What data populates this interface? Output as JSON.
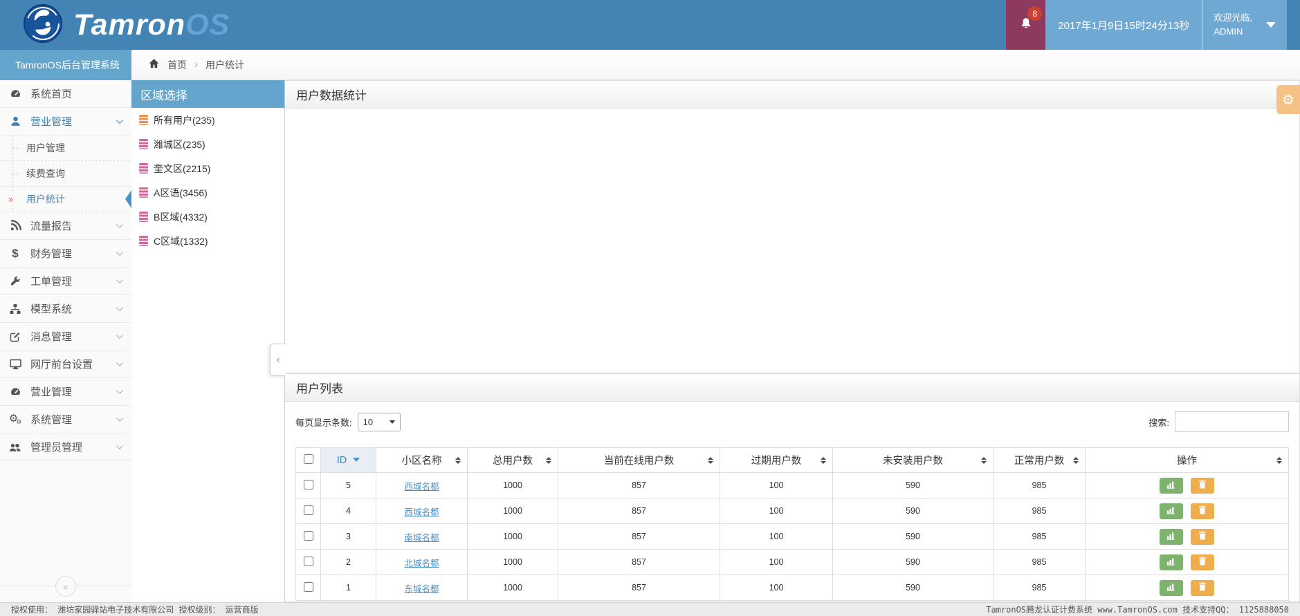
{
  "colors": {
    "navbar": "#4484b4",
    "navbar_light_box": "#6fa9d3",
    "bell_box": "#8e3a5e",
    "badge": "#c94130",
    "panel_blue_header": "#64a5ce",
    "active_blue": "#3e81b1",
    "link_blue": "#4a90c8",
    "button_green": "#7db36c",
    "button_orange": "#f0ad4e",
    "gear_tab": "#f6c184",
    "region_icon_orange": "#f19149",
    "region_icon_pink": "#d8649f"
  },
  "icons": {
    "gear": "⚙",
    "gears_small": "⚙",
    "dollar": "$",
    "collapse_panel": "‹",
    "collapse_sidebar": "«",
    "breadcrumb_separator": "›"
  },
  "navbar": {
    "brand_primary": "Tamron",
    "brand_secondary": "OS",
    "notification_count": "8",
    "datetime": "2017年1月9日15时24分13秒",
    "welcome_greeting": "欢迎光临,",
    "welcome_user": "ADMIN"
  },
  "sidebar": {
    "title": "TamronOS后台管理系统",
    "items": [
      {
        "label": "系统首页"
      },
      {
        "label": "营业管理"
      },
      {
        "label": "用户管理"
      },
      {
        "label": "续费查询"
      },
      {
        "label": "用户统计"
      },
      {
        "label": "流量报告"
      },
      {
        "label": "财务管理"
      },
      {
        "label": "工单管理"
      },
      {
        "label": "模型系统"
      },
      {
        "label": "消息管理"
      },
      {
        "label": "网厅前台设置"
      },
      {
        "label": "营业管理"
      },
      {
        "label": "系统管理"
      },
      {
        "label": "管理员管理"
      }
    ],
    "active_sub_marker": "»"
  },
  "breadcrumb": {
    "home": "首页",
    "current": "用户统计"
  },
  "region_panel": {
    "title": "区域选择",
    "items": [
      {
        "label": "所有用户(235)"
      },
      {
        "label": "潍城区(235)"
      },
      {
        "label": "奎文区(2215)"
      },
      {
        "label": "A区语(3456)"
      },
      {
        "label": "B区域(4332)"
      },
      {
        "label": "C区域(1332)"
      }
    ]
  },
  "stats_panel": {
    "title": "用户数据统计"
  },
  "list_panel": {
    "title": "用户列表",
    "per_page_label": "每页显示条数:",
    "per_page_value": "10",
    "search_label": "搜索:"
  },
  "table": {
    "columns": [
      "ID",
      "小区名称",
      "总用户数",
      "当前在线用户数",
      "过期用户数",
      "未安装用户数",
      "正常用户数",
      "操作"
    ],
    "rows": [
      {
        "id": "5",
        "name": "西城名都",
        "total": "1000",
        "online": "857",
        "expired": "100",
        "uninstalled": "590",
        "normal": "985"
      },
      {
        "id": "4",
        "name": "西城名都",
        "total": "1000",
        "online": "857",
        "expired": "100",
        "uninstalled": "590",
        "normal": "985"
      },
      {
        "id": "3",
        "name": "南城名都",
        "total": "1000",
        "online": "857",
        "expired": "100",
        "uninstalled": "590",
        "normal": "985"
      },
      {
        "id": "2",
        "name": "北城名都",
        "total": "1000",
        "online": "857",
        "expired": "100",
        "uninstalled": "590",
        "normal": "985"
      },
      {
        "id": "1",
        "name": "东城名都",
        "total": "1000",
        "online": "857",
        "expired": "100",
        "uninstalled": "590",
        "normal": "985"
      }
    ]
  },
  "footer": {
    "left": "授权使用： 潍坊家园驿站电子技术有限公司  授权级别： 运营商版",
    "right": "TamronOS腾龙认证计费系统 www.TamronOS.com 技术支持QQ： 1125888050"
  }
}
